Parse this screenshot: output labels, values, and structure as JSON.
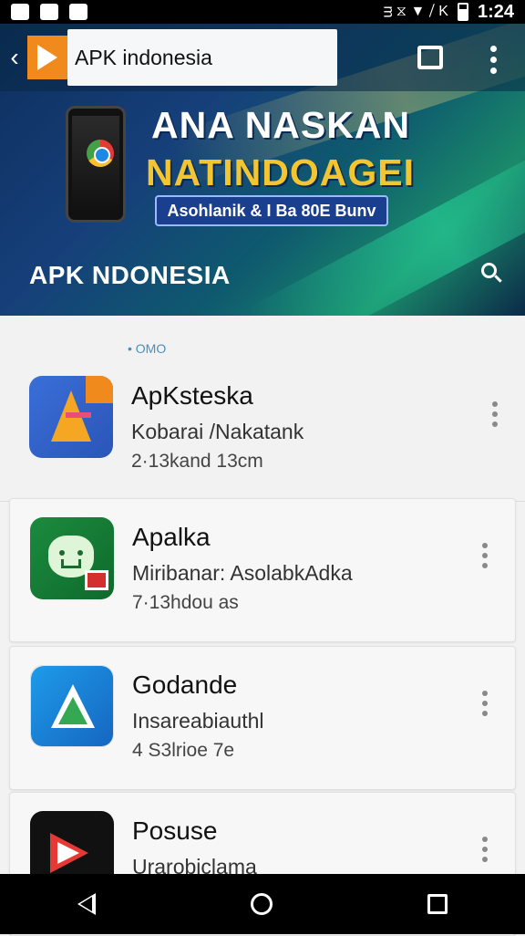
{
  "status_bar": {
    "time": "1:24",
    "indicators": "ᴟ ⧖ ▼ ⧸ K"
  },
  "app_bar": {
    "title": "APK indonesia"
  },
  "hero": {
    "line1": "ANA NASKAN",
    "line2": "NATINDOAGEI",
    "pill": "Asohlanik & I Ba 80E Bunv",
    "subtitle": "APK NDONESIA"
  },
  "section_label": "• OMO",
  "apps": [
    {
      "name": "ApKsteska",
      "subtitle": "Kobarai /Nakatank",
      "meta": "2·13kand 13cm",
      "icon": "apk-a-icon"
    },
    {
      "name": "Apalka",
      "subtitle": "Miribanar: AsolabkAdka",
      "meta": "7·13hdou as",
      "icon": "green-face-icon"
    },
    {
      "name": "Godande",
      "subtitle": "Insareabiauthl",
      "meta": "4 S3lrioe 7e",
      "icon": "blue-triangle-icon"
    },
    {
      "name": "Posuse",
      "subtitle": "Urarobiclama",
      "meta": "",
      "icon": "red-play-icon"
    }
  ],
  "colors": {
    "accent": "#f08a1c",
    "hero_bg": "#0d2f5c",
    "hero_yellow": "#f2c531"
  }
}
